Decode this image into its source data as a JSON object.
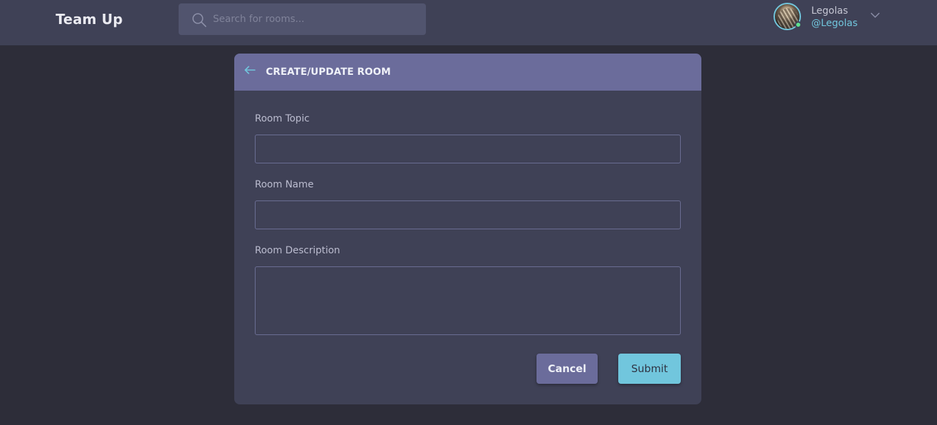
{
  "header": {
    "brand": "Team Up",
    "search": {
      "placeholder": "Search for rooms...",
      "value": "",
      "icon": "search-icon"
    },
    "user": {
      "name": "Legolas",
      "handle": "@Legolas",
      "status": "online",
      "menu_icon": "chevron-down-icon"
    }
  },
  "form": {
    "title": "CREATE/UPDATE ROOM",
    "back_icon": "arrow-left-icon",
    "fields": [
      {
        "label": "Room Topic",
        "value": ""
      },
      {
        "label": "Room Name",
        "value": ""
      },
      {
        "label": "Room Description",
        "value": ""
      }
    ],
    "buttons": {
      "cancel": "Cancel",
      "submit": "Submit"
    }
  },
  "colors": {
    "page_bg": "#2d2d39",
    "topbar_bg": "#3f4156",
    "card_header": "#6b6c9b",
    "accent": "#71c6dd",
    "online": "#5ee18e"
  }
}
